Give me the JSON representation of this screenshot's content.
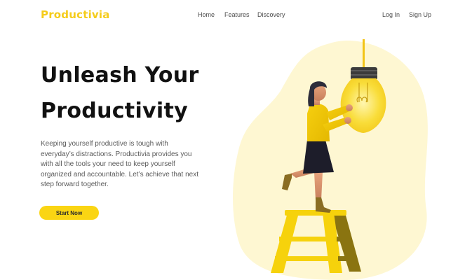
{
  "brand": {
    "name": "Productivia",
    "color": "#f5cc1b"
  },
  "nav": {
    "links": [
      "Home",
      "Features",
      "Discovery"
    ],
    "auth": [
      "Log In",
      "Sign Up"
    ]
  },
  "hero": {
    "headline_line1": "Unleash Your",
    "headline_line2": "Productivity",
    "description": "Keeping yourself productive is tough with everyday’s distractions. Productivia provides you with all the tools your need to keep yourself organized and accountable. Let’s achieve that next step forward together.",
    "cta_label": "Start Now",
    "cta_color": "#fad513"
  },
  "illustration": {
    "icons": [
      "light-bulb-icon",
      "woman-figure",
      "step-ladder-icon"
    ],
    "blob_color": "#fef7d2"
  }
}
